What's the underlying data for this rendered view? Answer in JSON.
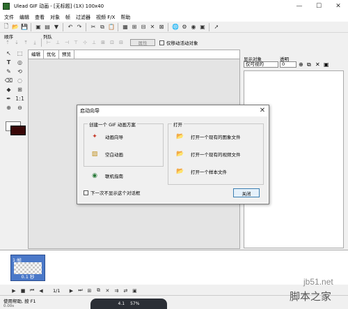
{
  "window": {
    "title": "Ulead GIF 动画 - [无标题] (1X) 100x40",
    "minimize": "—",
    "restore": "☐",
    "close": "✕"
  },
  "menu": [
    "文件",
    "编辑",
    "查看",
    "对象",
    "帧",
    "过滤器",
    "视频 F/X",
    "帮助"
  ],
  "toolbar_labels": {
    "order": "顺序",
    "arrange": "列队"
  },
  "toolbar2": {
    "properties": "属性",
    "move_only_checkbox": "仅移动活动对象"
  },
  "doc_tabs": [
    "编辑",
    "优化",
    "预览"
  ],
  "right_panel": {
    "show_objects_label": "显示对象",
    "transparency_label": "透明",
    "show_objects_value": "仅可视的",
    "transparency_value": "0"
  },
  "frame_panel": {
    "frame_label": "1:帧",
    "frame_delay": "0.1 秒",
    "page_count": "1/1"
  },
  "status": {
    "text": "使用帮助, 按 F1",
    "sub": "0.00s"
  },
  "taskbar": {
    "a": "4.1",
    "b": "57%"
  },
  "watermarks": {
    "line1": "jb51.net",
    "line2": "脚本之家"
  },
  "dialog": {
    "title": "启动向导",
    "create_group": "创建一个 GIF 动画方案",
    "open_group": "打开",
    "options": {
      "wizard": "动画向导",
      "blank": "空白动画",
      "online_guide": "联机指南",
      "open_image": "打开一个现有的图象文件",
      "open_video": "打开一个现有的视频文件",
      "open_sample": "打开一个样本文件"
    },
    "dont_show": "下一次不显示这个对话框",
    "close_button": "关闭"
  },
  "colors": {
    "frame_thumb": "#4a78c8",
    "background_color": "#3a0808",
    "dialog_border": "#7a7a7a",
    "close_button_border": "#3c7fb1"
  }
}
